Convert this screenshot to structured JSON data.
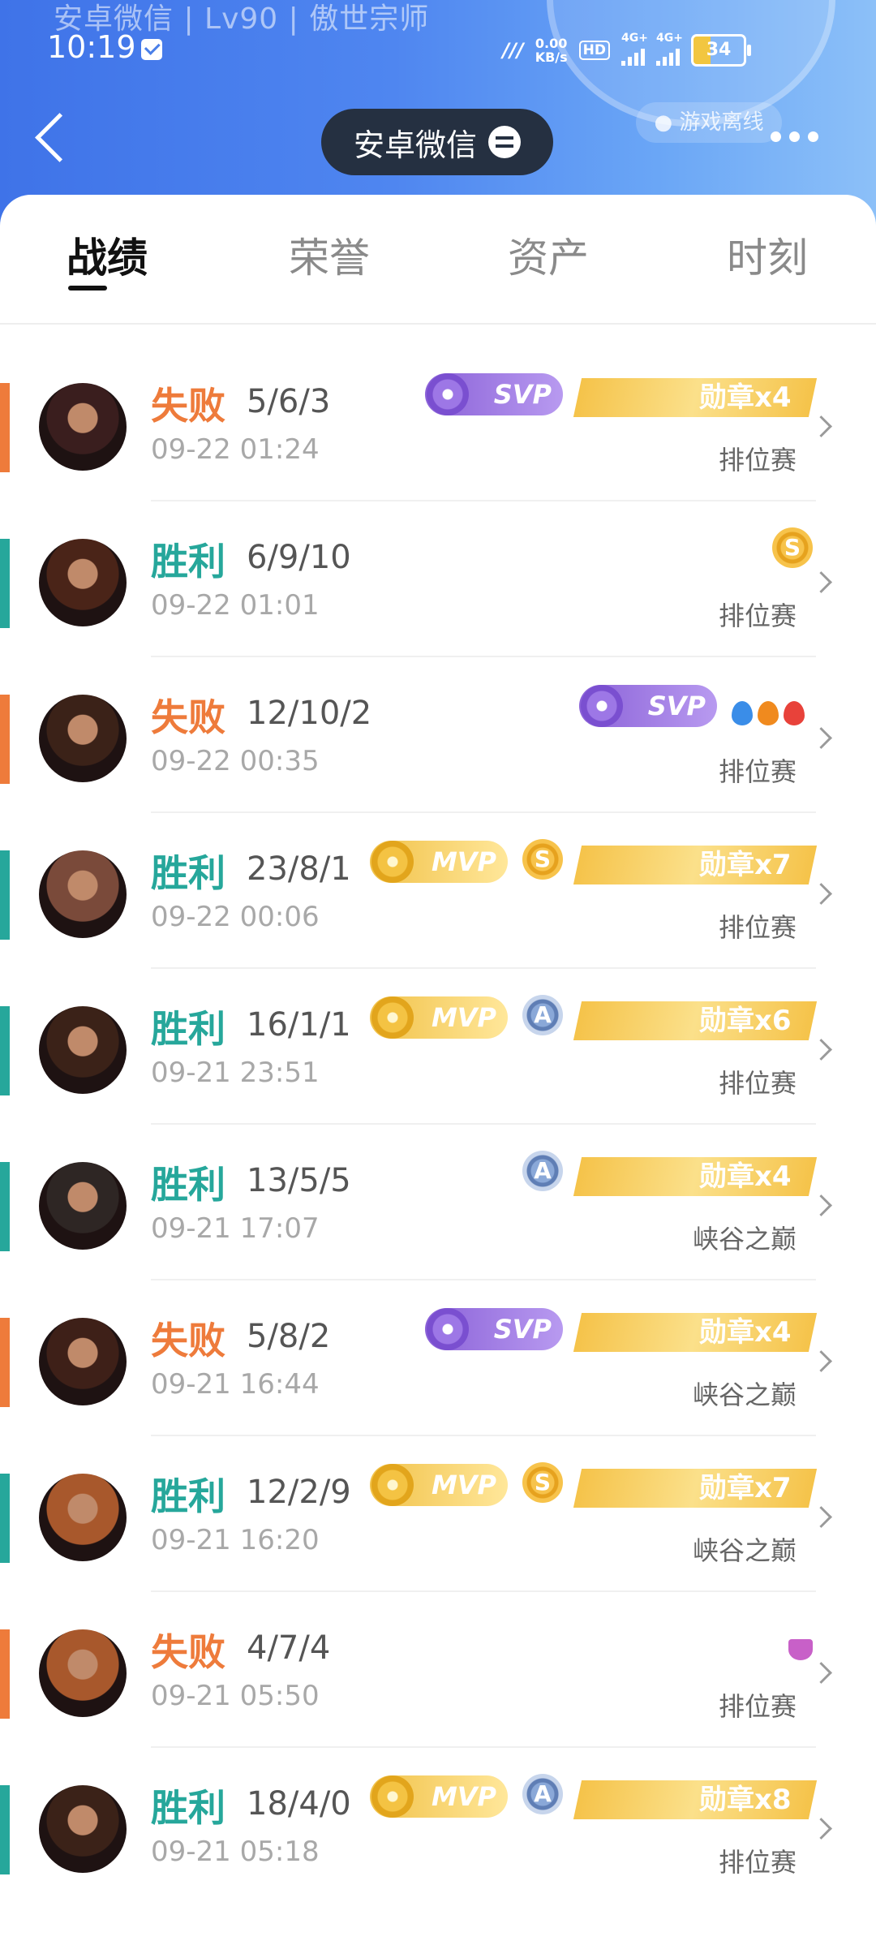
{
  "status": {
    "faded_profile": "安卓微信 | Lv90 | 傲世宗师",
    "time": "10:19",
    "net_speed_value": "0.00",
    "net_speed_unit": "KB/s",
    "hd_label": "HD",
    "signal1": "4G+",
    "signal2": "4G+",
    "battery": "34"
  },
  "header": {
    "account": "安卓微信",
    "offline": "● 游戏离线"
  },
  "tabs": [
    "战绩",
    "荣誉",
    "资产",
    "时刻"
  ],
  "colors": {
    "win": "#26a79b",
    "lose": "#ee7b3b",
    "header_blue": "#4f86f0"
  },
  "matches": [
    {
      "result": "失败",
      "kda": "5/6/3",
      "time": "09-22 01:24",
      "mode": "排位赛",
      "badges": [
        "svp",
        "medal"
      ],
      "medal": "勋章x4"
    },
    {
      "result": "胜利",
      "kda": "6/9/10",
      "time": "09-22 01:01",
      "mode": "排位赛",
      "badges": [
        "s"
      ]
    },
    {
      "result": "失败",
      "kda": "12/10/2",
      "time": "09-22 00:35",
      "mode": "排位赛",
      "badges": [
        "svp",
        "tags"
      ]
    },
    {
      "result": "胜利",
      "kda": "23/8/1",
      "time": "09-22 00:06",
      "mode": "排位赛",
      "badges": [
        "mvp",
        "s",
        "medal"
      ],
      "medal": "勋章x7"
    },
    {
      "result": "胜利",
      "kda": "16/1/1",
      "time": "09-21 23:51",
      "mode": "排位赛",
      "badges": [
        "mvp",
        "a",
        "medal"
      ],
      "medal": "勋章x6"
    },
    {
      "result": "胜利",
      "kda": "13/5/5",
      "time": "09-21 17:07",
      "mode": "峡谷之巅",
      "badges": [
        "a",
        "medal"
      ],
      "medal": "勋章x4"
    },
    {
      "result": "失败",
      "kda": "5/8/2",
      "time": "09-21 16:44",
      "mode": "峡谷之巅",
      "badges": [
        "svp",
        "medal"
      ],
      "medal": "勋章x4"
    },
    {
      "result": "胜利",
      "kda": "12/2/9",
      "time": "09-21 16:20",
      "mode": "峡谷之巅",
      "badges": [
        "mvp",
        "s",
        "medal"
      ],
      "medal": "勋章x7"
    },
    {
      "result": "失败",
      "kda": "4/7/4",
      "time": "09-21 05:50",
      "mode": "排位赛",
      "badges": [
        "demon"
      ]
    },
    {
      "result": "胜利",
      "kda": "18/4/0",
      "time": "09-21 05:18",
      "mode": "排位赛",
      "badges": [
        "mvp",
        "a",
        "medal"
      ],
      "medal": "勋章x8"
    }
  ],
  "badge_text": {
    "svp": "SVP",
    "mvp": "MVP",
    "s": "S",
    "a": "A"
  },
  "avatar_colors": [
    "#3a1e1e",
    "#4a2418",
    "#3b2218",
    "#7a4a3a",
    "#3b2218",
    "#2e2624",
    "#3e2018",
    "#a8582c",
    "#a8582c",
    "#3b2218"
  ]
}
